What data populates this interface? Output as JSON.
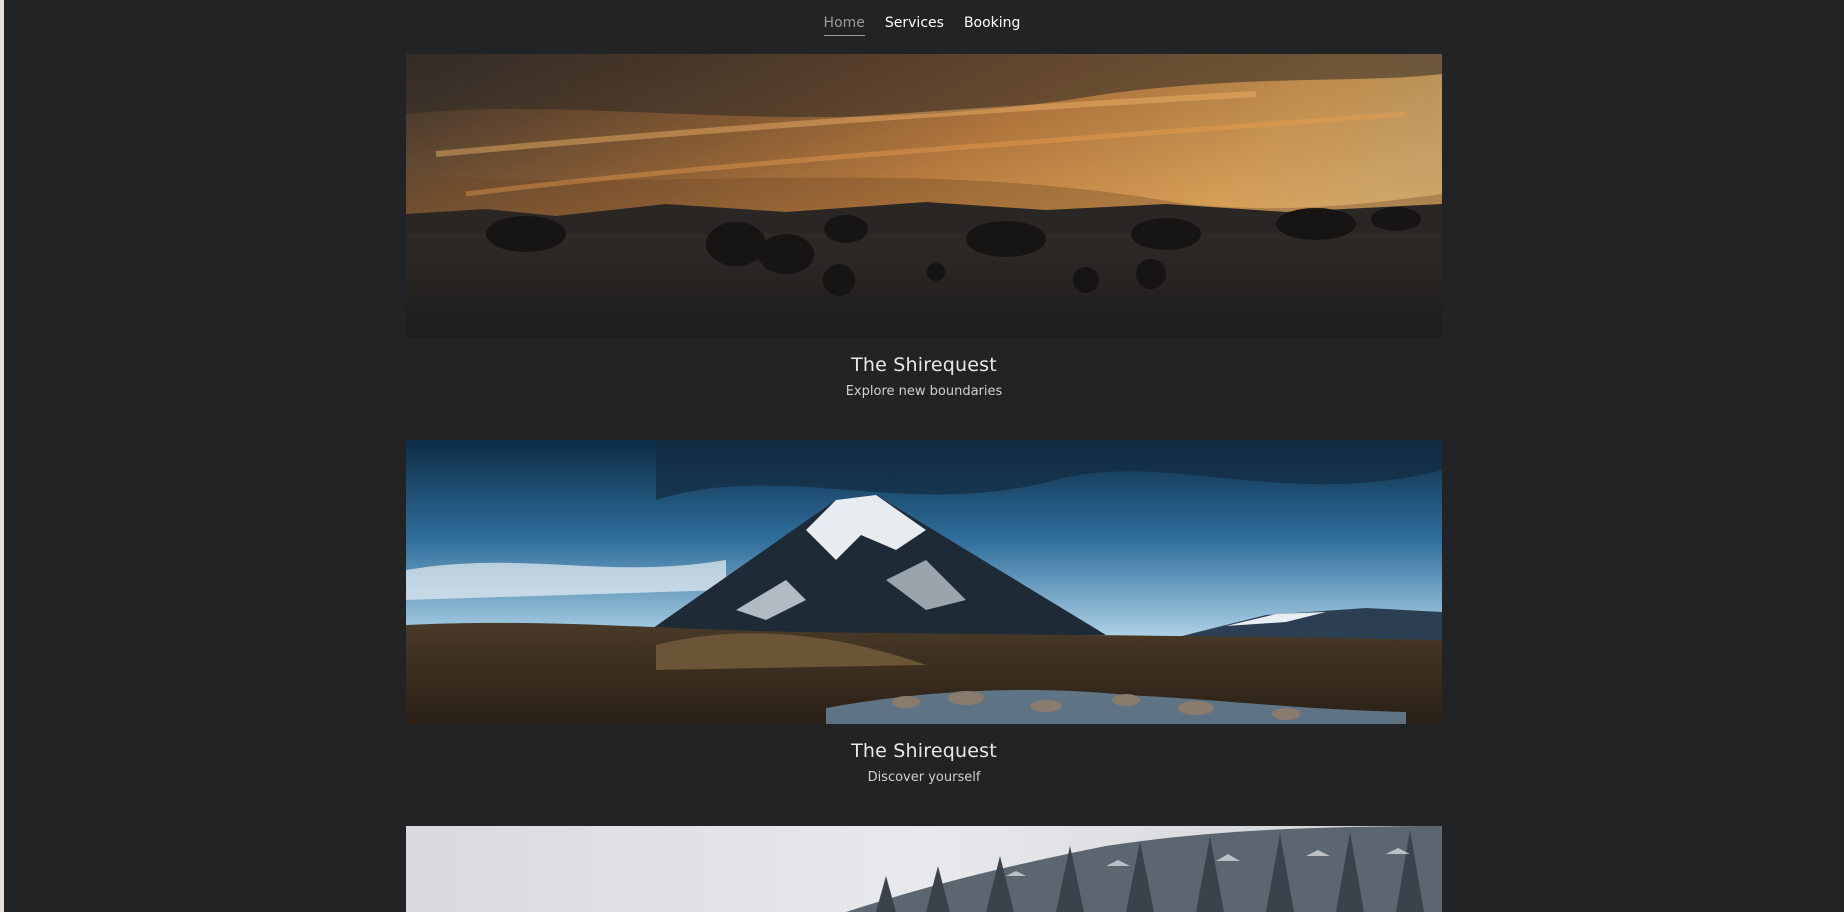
{
  "nav": {
    "items": [
      {
        "label": "Home",
        "active": true
      },
      {
        "label": "Services",
        "active": false
      },
      {
        "label": "Booking",
        "active": false
      }
    ]
  },
  "sections": [
    {
      "title": "The Shirequest",
      "subtitle": "Explore new boundaries",
      "image": "sunset-countryside-trees-photo"
    },
    {
      "title": "The Shirequest",
      "subtitle": "Discover yourself",
      "image": "snowy-mountain-river-photo"
    },
    {
      "title": "",
      "subtitle": "",
      "image": "snowy-forest-photo"
    }
  ],
  "colors": {
    "background": "#212325",
    "nav_text": "#ffffff",
    "nav_active": "#9a9a9a"
  }
}
